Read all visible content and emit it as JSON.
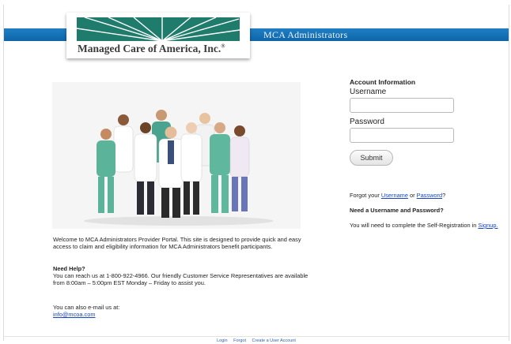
{
  "header": {
    "title": "MCA Administrators",
    "logo_text": "Managed Care of America, Inc.",
    "logo_reg": "®"
  },
  "photo": {
    "description_icon": "doctors-group-photo"
  },
  "intro": {
    "text": "Welcome to MCA Administrators Provider Portal.  This site is designed to provide quick and easy access to claim and eligibility information for MCA Administrators benefit participants."
  },
  "help": {
    "heading": "Need Help?",
    "text": "You can reach us at 1-800-922-4966.  Our friendly Customer Service Representatives are available from 8:00am – 5:00pm EST Monday – Friday to assist you.",
    "email_prompt": "You can also e-mail us at:",
    "email": "info@mcoa.com"
  },
  "account": {
    "heading": "Account Information",
    "username_label": "Username",
    "username_value": "",
    "password_label": "Password",
    "password_value": "",
    "submit_label": "Submit",
    "forgot_prefix": "Forgot your ",
    "forgot_username": "Username",
    "forgot_or": " or ",
    "forgot_password": "Password",
    "forgot_suffix": "?",
    "need_heading": "Need a Username and Password?",
    "need_text": "You will need to complete the Self-Registration in ",
    "signup_link": "Signup."
  },
  "footer": {
    "links": [
      "Login",
      "Forgot",
      "Create a User Account"
    ]
  },
  "colors": {
    "banner": "#1677bd",
    "logo_green": "#1f7b6b",
    "link": "#1a44c8"
  }
}
